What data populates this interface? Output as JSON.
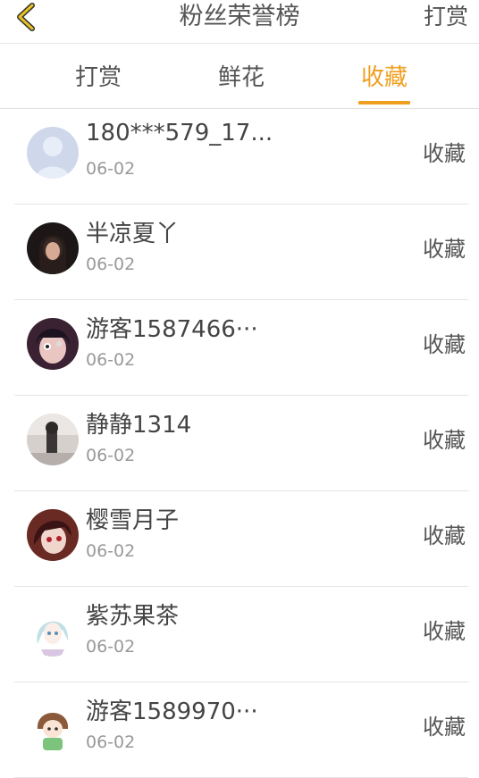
{
  "header": {
    "back_icon": "chevron-left-icon",
    "title": "粉丝荣誉榜",
    "right_label": "打赏"
  },
  "tabs": [
    {
      "label": "打赏",
      "active": false
    },
    {
      "label": "鲜花",
      "active": false
    },
    {
      "label": "收藏",
      "active": true
    }
  ],
  "colors": {
    "accent": "#f0a020",
    "back_icon": "#e8c020"
  },
  "fans": [
    {
      "name": "180***579_17...",
      "date": "06-02",
      "action": "收藏",
      "avatar": "default-avatar-icon"
    },
    {
      "name": "半凉夏丫",
      "date": "06-02",
      "action": "收藏",
      "avatar": "user-avatar"
    },
    {
      "name": "游客1587466···",
      "date": "06-02",
      "action": "收藏",
      "avatar": "user-avatar"
    },
    {
      "name": "静静1314",
      "date": "06-02",
      "action": "收藏",
      "avatar": "user-avatar"
    },
    {
      "name": "樱雪月子",
      "date": "06-02",
      "action": "收藏",
      "avatar": "user-avatar"
    },
    {
      "name": "紫苏果茶",
      "date": "06-02",
      "action": "收藏",
      "avatar": "user-avatar"
    },
    {
      "name": "游客1589970···",
      "date": "06-02",
      "action": "收藏",
      "avatar": "user-avatar"
    }
  ]
}
